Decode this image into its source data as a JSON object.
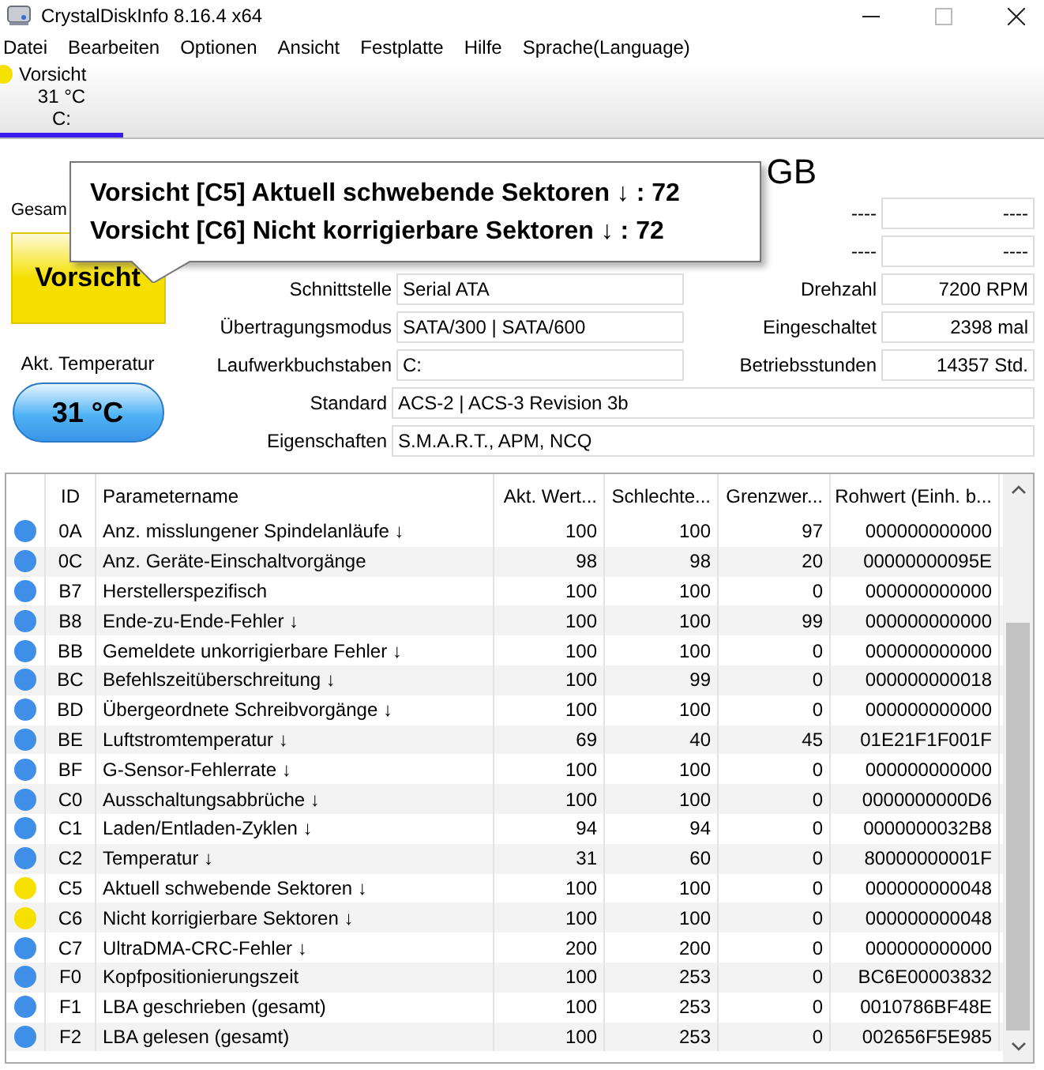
{
  "window": {
    "title": "CrystalDiskInfo 8.16.4 x64"
  },
  "menu": [
    "Datei",
    "Bearbeiten",
    "Optionen",
    "Ansicht",
    "Festplatte",
    "Hilfe",
    "Sprache(Language)"
  ],
  "disk_tabs": [
    {
      "status": "Vorsicht",
      "temperature": "31 °C",
      "drive": "C:",
      "color": "#f5e000",
      "selected": true
    }
  ],
  "model_title": "GB",
  "tooltip": {
    "lines": [
      "Vorsicht [C5] Aktuell schwebende Sektoren ↓ : 72",
      "Vorsicht [C6] Nicht korrigierbare Sektoren ↓ : 72"
    ]
  },
  "health": {
    "label": "Gesam",
    "status": "Vorsicht",
    "temperature_label": "Akt. Temperatur",
    "temperature": "31 °C"
  },
  "info_left": [
    {
      "label": "Schnittstelle",
      "value": "Serial ATA"
    },
    {
      "label": "Übertragungsmodus",
      "value": "SATA/300 | SATA/600"
    },
    {
      "label": "Laufwerkbuchstaben",
      "value": "C:"
    }
  ],
  "info_wide": [
    {
      "label": "Standard",
      "value": "ACS-2 | ACS-3 Revision 3b"
    },
    {
      "label": "Eigenschaften",
      "value": "S.M.A.R.T., APM, NCQ"
    }
  ],
  "info_right": [
    {
      "label": "----",
      "value": "----"
    },
    {
      "label": "----",
      "value": "----"
    },
    {
      "label": "Drehzahl",
      "value": "7200 RPM"
    },
    {
      "label": "Eingeschaltet",
      "value": "2398 mal"
    },
    {
      "label": "Betriebsstunden",
      "value": "14357 Std."
    }
  ],
  "table": {
    "columns": [
      "ID",
      "Parametername",
      "Akt. Wert...",
      "Schlechte...",
      "Grenzwer...",
      "Rohwert (Einh. b..."
    ],
    "rows": [
      {
        "color": "#3f8fe8",
        "cells": [
          "0A",
          "Anz. misslungener Spindelanläufe ↓",
          "100",
          "100",
          "97",
          "000000000000"
        ]
      },
      {
        "color": "#3f8fe8",
        "cells": [
          "0C",
          "Anz. Geräte-Einschaltvorgänge",
          "98",
          "98",
          "20",
          "00000000095E"
        ]
      },
      {
        "color": "#3f8fe8",
        "cells": [
          "B7",
          "Herstellerspezifisch",
          "100",
          "100",
          "0",
          "000000000000"
        ]
      },
      {
        "color": "#3f8fe8",
        "cells": [
          "B8",
          "Ende-zu-Ende-Fehler ↓",
          "100",
          "100",
          "99",
          "000000000000"
        ]
      },
      {
        "color": "#3f8fe8",
        "cells": [
          "BB",
          "Gemeldete unkorrigierbare Fehler ↓",
          "100",
          "100",
          "0",
          "000000000000"
        ]
      },
      {
        "color": "#3f8fe8",
        "cells": [
          "BC",
          "Befehlszeitüberschreitung ↓",
          "100",
          "99",
          "0",
          "000000000018"
        ]
      },
      {
        "color": "#3f8fe8",
        "cells": [
          "BD",
          "Übergeordnete Schreibvorgänge ↓",
          "100",
          "100",
          "0",
          "000000000000"
        ]
      },
      {
        "color": "#3f8fe8",
        "cells": [
          "BE",
          "Luftstromtemperatur ↓",
          "69",
          "40",
          "45",
          "01E21F1F001F"
        ]
      },
      {
        "color": "#3f8fe8",
        "cells": [
          "BF",
          "G-Sensor-Fehlerrate ↓",
          "100",
          "100",
          "0",
          "000000000000"
        ]
      },
      {
        "color": "#3f8fe8",
        "cells": [
          "C0",
          "Ausschaltungsabbrüche ↓",
          "100",
          "100",
          "0",
          "0000000000D6"
        ]
      },
      {
        "color": "#3f8fe8",
        "cells": [
          "C1",
          "Laden/Entladen-Zyklen ↓",
          "94",
          "94",
          "0",
          "0000000032B8"
        ]
      },
      {
        "color": "#3f8fe8",
        "cells": [
          "C2",
          "Temperatur ↓",
          "31",
          "60",
          "0",
          "80000000001F"
        ]
      },
      {
        "color": "#f5e000",
        "cells": [
          "C5",
          "Aktuell schwebende Sektoren ↓",
          "100",
          "100",
          "0",
          "000000000048"
        ]
      },
      {
        "color": "#f5e000",
        "cells": [
          "C6",
          "Nicht korrigierbare Sektoren ↓",
          "100",
          "100",
          "0",
          "000000000048"
        ]
      },
      {
        "color": "#3f8fe8",
        "cells": [
          "C7",
          "UltraDMA-CRC-Fehler ↓",
          "200",
          "200",
          "0",
          "000000000000"
        ]
      },
      {
        "color": "#3f8fe8",
        "cells": [
          "F0",
          "Kopfpositionierungszeit",
          "100",
          "253",
          "0",
          "BC6E00003832"
        ]
      },
      {
        "color": "#3f8fe8",
        "cells": [
          "F1",
          "LBA geschrieben (gesamt)",
          "100",
          "253",
          "0",
          "0010786BF48E"
        ]
      },
      {
        "color": "#3f8fe8",
        "cells": [
          "F2",
          "LBA gelesen (gesamt)",
          "100",
          "253",
          "0",
          "002656F5E985"
        ]
      }
    ]
  }
}
